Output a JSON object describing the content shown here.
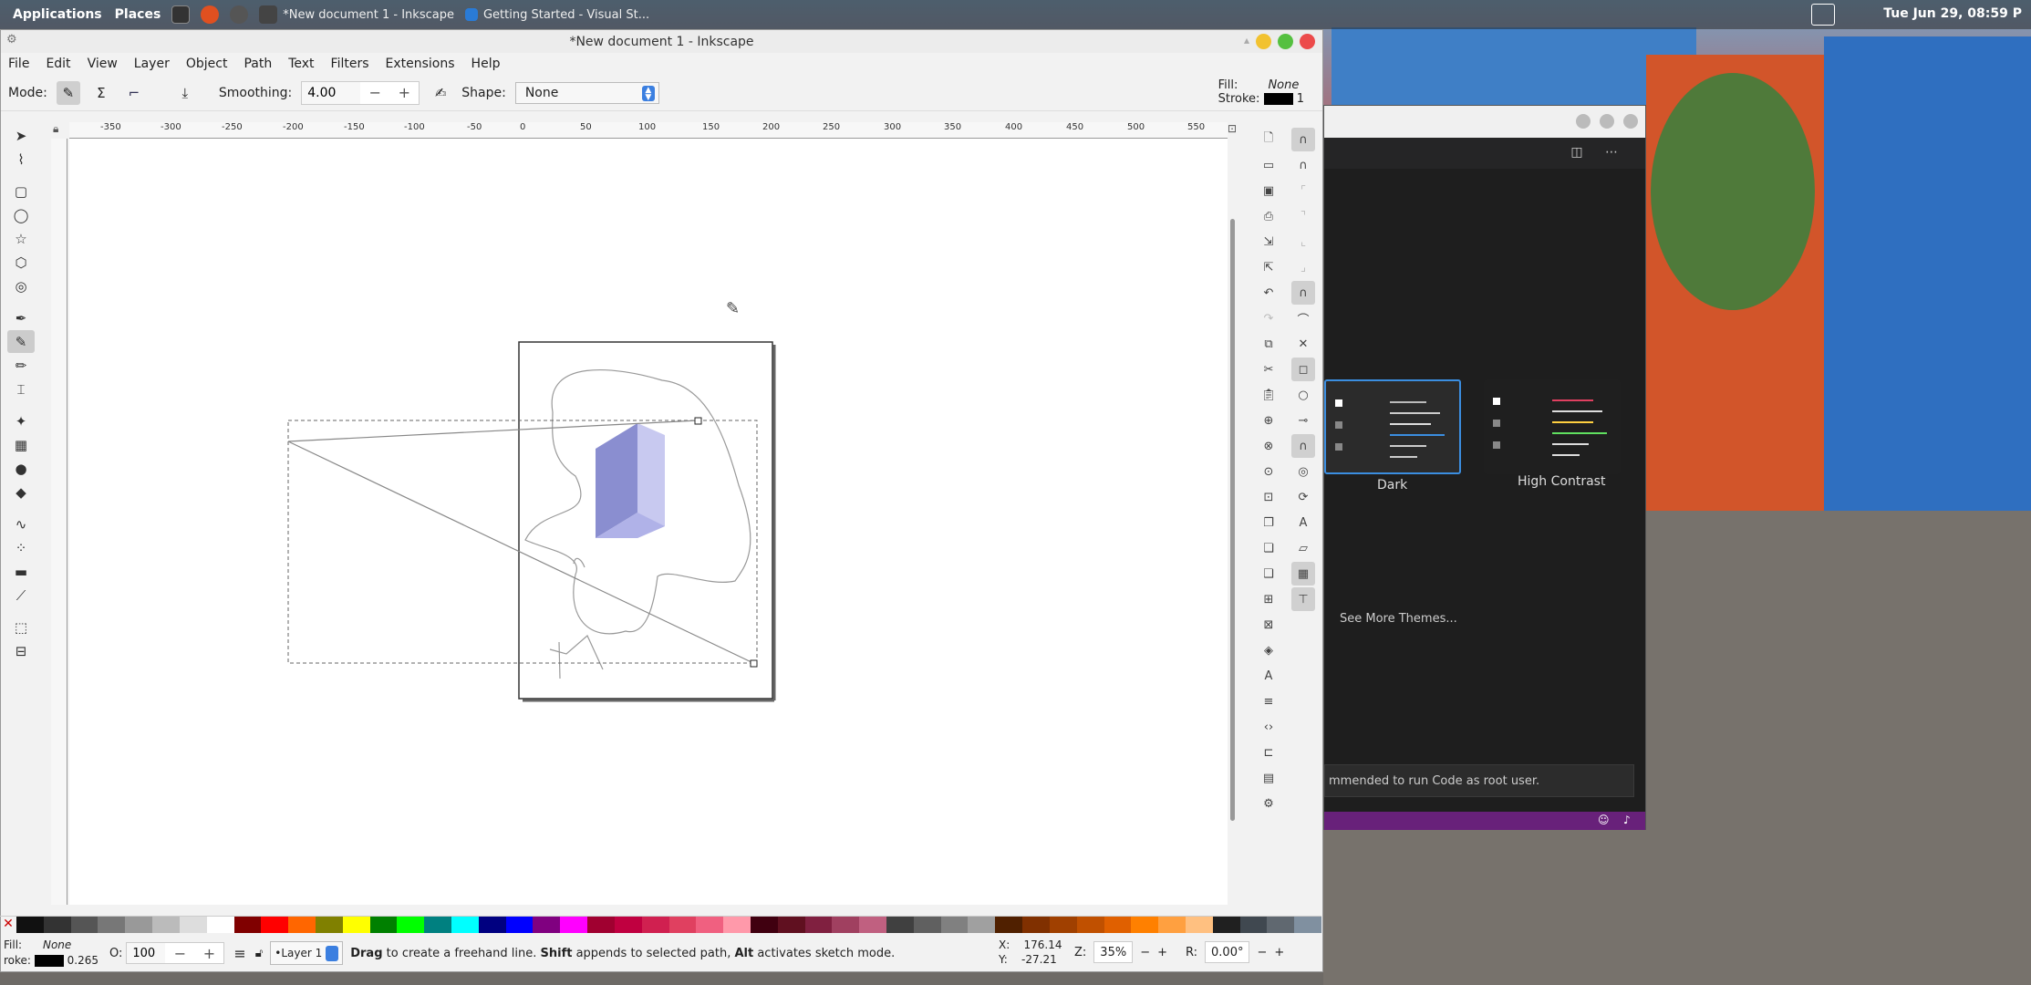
{
  "top_panel": {
    "applications": "Applications",
    "places": "Places",
    "tasks": [
      "*New document 1 - Inkscape",
      "Getting Started - Visual St..."
    ],
    "clock": "Tue Jun 29, 08:59 P"
  },
  "inkscape": {
    "title": "*New document 1 - Inkscape",
    "menu": [
      "File",
      "Edit",
      "View",
      "Layer",
      "Object",
      "Path",
      "Text",
      "Filters",
      "Extensions",
      "Help"
    ],
    "toolbar": {
      "mode_label": "Mode:",
      "smoothing_label": "Smoothing:",
      "smoothing_value": "4.00",
      "shape_label": "Shape:",
      "shape_value": "None",
      "fill_label": "Fill:",
      "fill_value": "None",
      "stroke_label": "Stroke:",
      "stroke_value": "1"
    },
    "ruler_labels": [
      "-350",
      "-300",
      "-250",
      "-200",
      "-150",
      "-100",
      "-50",
      "0",
      "50",
      "100",
      "150",
      "200",
      "250",
      "300",
      "350",
      "400",
      "450",
      "500",
      "550"
    ],
    "status": {
      "fill_label": "Fill:",
      "fill_value": "None",
      "stroke_label": "roke:",
      "stroke_width": "0.265",
      "opacity_label": "O:",
      "opacity_value": "100",
      "layer": "•Layer 1",
      "message_bold_1": "Drag",
      "message_1": " to create a freehand line. ",
      "message_bold_2": "Shift",
      "message_2": " appends to selected path, ",
      "message_bold_3": "Alt",
      "message_3": " activates sketch mode.",
      "x_label": "X:",
      "x_value": "176.14",
      "y_label": "Y:",
      "y_value": "-27.21",
      "zoom_label": "Z:",
      "zoom_value": "35%",
      "rotate_label": "R:",
      "rotate_value": "0.00°"
    },
    "palette": [
      "#111",
      "#333",
      "#555",
      "#777",
      "#999",
      "#bbb",
      "#ddd",
      "#fff",
      "#800000",
      "#ff0000",
      "#ff6600",
      "#808000",
      "#ffff00",
      "#008000",
      "#00ff00",
      "#008080",
      "#00ffff",
      "#000080",
      "#0000ff",
      "#800080",
      "#ff00ff",
      "#a00030",
      "#c00040",
      "#d02050",
      "#e04060",
      "#f06080",
      "#ff99aa",
      "#400010",
      "#601020",
      "#802040",
      "#a04060",
      "#c06080",
      "#404040",
      "#606060",
      "#808080",
      "#a0a0a0",
      "#502000",
      "#803000",
      "#a04000",
      "#c05000",
      "#e06000",
      "#ff8000",
      "#ffa040",
      "#ffc080",
      "#202020",
      "#404850",
      "#606870",
      "#8090a0"
    ]
  },
  "vscode": {
    "themes": [
      "Dark",
      "High Contrast"
    ],
    "see_more": "See More Themes...",
    "root_msg": "mmended to run Code as root user."
  }
}
